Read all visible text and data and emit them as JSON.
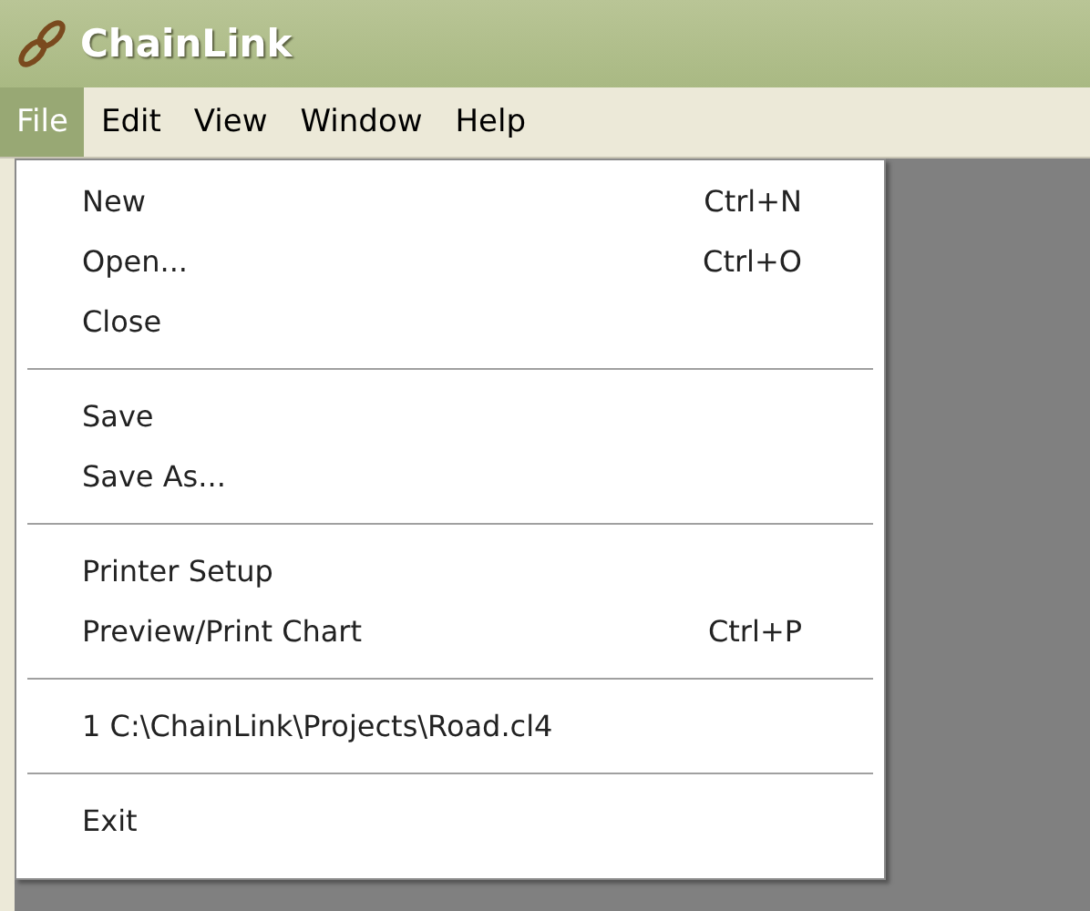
{
  "window": {
    "title": "ChainLink"
  },
  "menu_bar": [
    {
      "label": "File",
      "selected": true
    },
    {
      "label": "Edit",
      "selected": false
    },
    {
      "label": "View",
      "selected": false
    },
    {
      "label": "Window",
      "selected": false
    },
    {
      "label": "Help",
      "selected": false
    }
  ],
  "file_menu": {
    "groups": [
      [
        {
          "label": "New",
          "shortcut": "Ctrl+N"
        },
        {
          "label": "Open...",
          "shortcut": "Ctrl+O"
        },
        {
          "label": "Close"
        }
      ],
      [
        {
          "label": "Save"
        },
        {
          "label": "Save As..."
        }
      ],
      [
        {
          "label": "Printer Setup"
        },
        {
          "label": "Preview/Print Chart",
          "shortcut": "Ctrl+P"
        }
      ],
      [
        {
          "label": "1 C:\\ChainLink\\Projects\\Road.cl4"
        }
      ],
      [
        {
          "label": "Exit"
        }
      ]
    ]
  }
}
